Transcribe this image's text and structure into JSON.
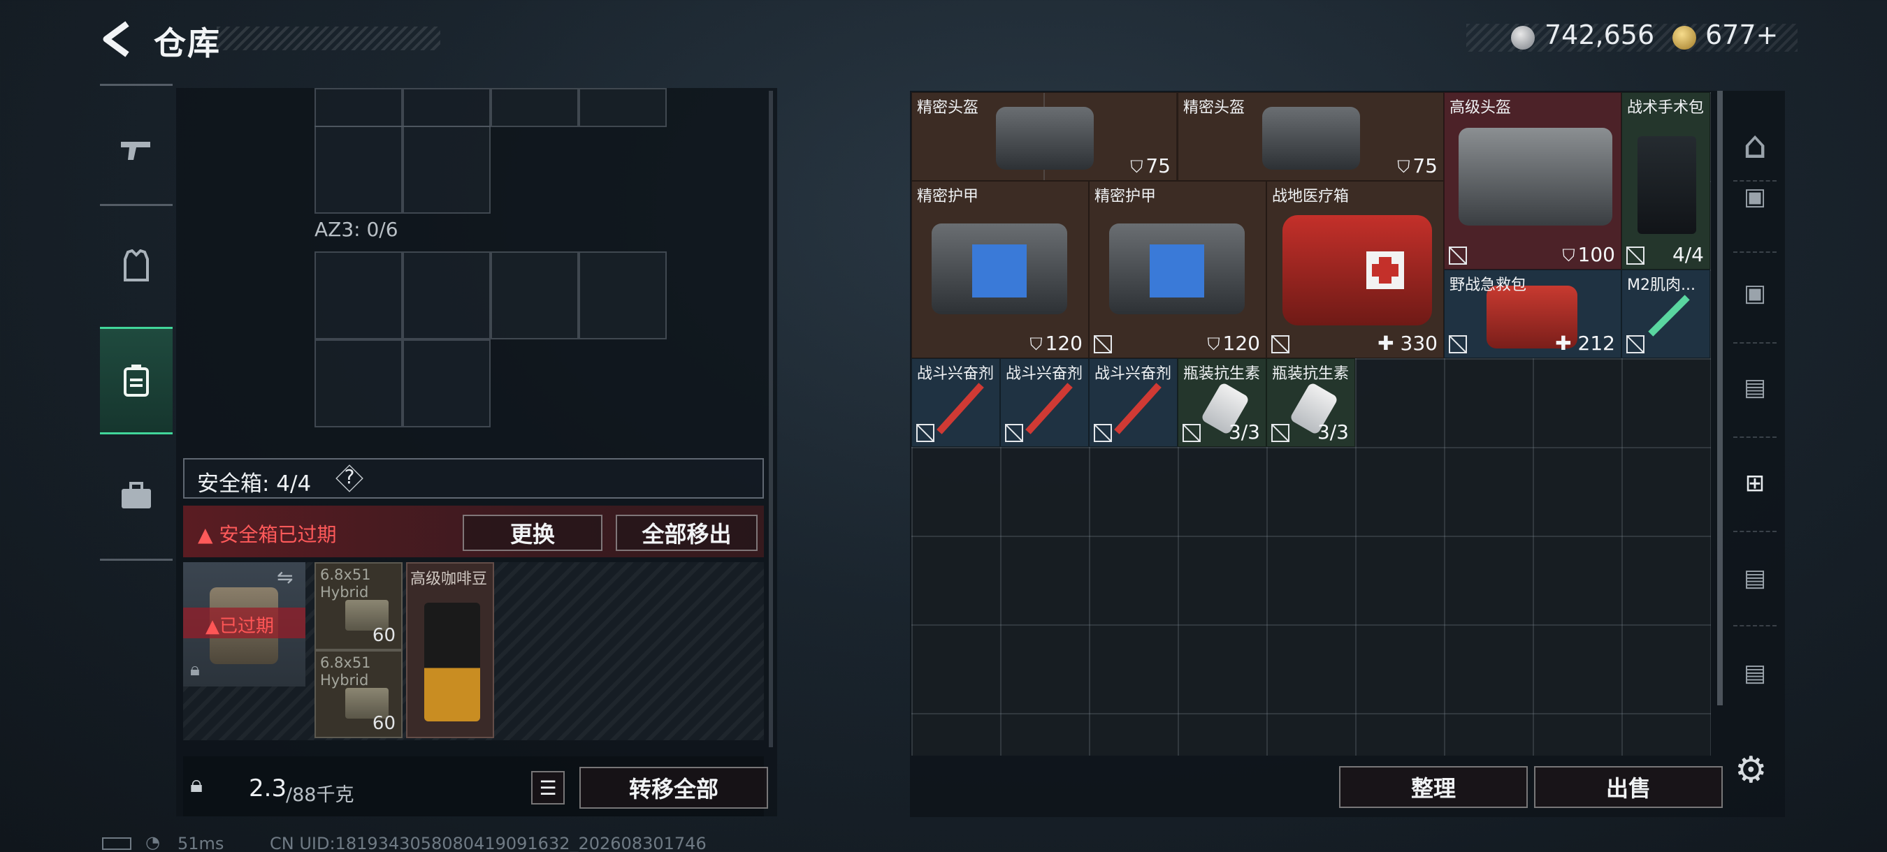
{
  "header": {
    "title": "仓库"
  },
  "currency": {
    "silver": "742,656",
    "gold": "677+"
  },
  "left_tabs": [
    {
      "name": "weapon",
      "icon": "pistol-icon"
    },
    {
      "name": "equipment",
      "icon": "vest-icon"
    },
    {
      "name": "container",
      "icon": "container-icon",
      "active": true
    },
    {
      "name": "case",
      "icon": "toolbox-icon"
    }
  ],
  "left_panel": {
    "az3_label": "AZ3: 0/6",
    "safebox_label": "安全箱: 4/4",
    "safebox_help": "?",
    "expired_warning": "安全箱已过期",
    "replace_label": "更换",
    "remove_all_label": "全部移出",
    "case_expired": "已过期",
    "items": [
      {
        "name": "6.8x51 Hybrid",
        "count": "60"
      },
      {
        "name": "6.8x51 Hybrid",
        "count": "60"
      },
      {
        "name": "高级咖啡豆",
        "count": ""
      }
    ],
    "weight_value": "2.3",
    "weight_max": "/88千克",
    "transfer_all_label": "转移全部"
  },
  "grid_items": [
    {
      "name": "精密头盔",
      "value": "75",
      "value_icon": "shield",
      "color": "brown"
    },
    {
      "name": "精密头盔",
      "value": "75",
      "value_icon": "shield",
      "color": "brown"
    },
    {
      "name": "高级头盔",
      "value": "100",
      "value_icon": "shield",
      "color": "red",
      "no_sell": true
    },
    {
      "name": "战术手术包",
      "value": "4/4",
      "color": "green",
      "no_sell": true
    },
    {
      "name": "精密护甲",
      "value": "120",
      "value_icon": "shield",
      "color": "brown"
    },
    {
      "name": "精密护甲",
      "value": "120",
      "value_icon": "shield",
      "color": "brown",
      "no_sell": true
    },
    {
      "name": "战地医疗箱",
      "value": "330",
      "value_icon": "plus",
      "color": "brown",
      "no_sell": true
    },
    {
      "name": "野战急救包",
      "value": "212",
      "value_icon": "plus",
      "color": "blue",
      "no_sell": true
    },
    {
      "name": "M2肌肉...",
      "value": "",
      "color": "blue",
      "no_sell": true
    },
    {
      "name": "战斗兴奋剂",
      "value": "",
      "color": "blue",
      "no_sell": true
    },
    {
      "name": "战斗兴奋剂",
      "value": "",
      "color": "blue",
      "no_sell": true
    },
    {
      "name": "战斗兴奋剂",
      "value": "",
      "color": "blue",
      "no_sell": true
    },
    {
      "name": "瓶装抗生素",
      "value": "3/3",
      "color": "green",
      "no_sell": true
    },
    {
      "name": "瓶装抗生素",
      "value": "3/3",
      "color": "green",
      "no_sell": true
    }
  ],
  "right_rail": [
    {
      "icon": "safehouse-icon"
    },
    {
      "icon": "ticket-icon"
    },
    {
      "icon": "ticket-icon"
    },
    {
      "icon": "folder-iv-icon"
    },
    {
      "icon": "add-folder-iv-icon"
    },
    {
      "icon": "folder-iv-icon"
    },
    {
      "icon": "folder-iv-icon"
    }
  ],
  "actions": {
    "sort_label": "整理",
    "sell_label": "出售"
  },
  "status_bar": {
    "ping": "51ms",
    "uid": "CN UID:1819343058080419091632_202608301746"
  },
  "colors": {
    "accent_green": "#41d69a",
    "warning_red": "#ff5a5a"
  }
}
